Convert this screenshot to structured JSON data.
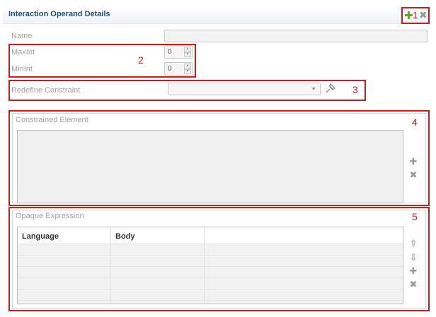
{
  "header": {
    "title": "Interaction Operand Details",
    "callout": "1",
    "add_icon": "add-icon",
    "remove_icon": "remove-icon"
  },
  "fields": {
    "name_label": "Name",
    "name_value": "",
    "maxint_label": "MaxInt",
    "maxint_value": "0",
    "minint_label": "MinInt",
    "minint_value": "0",
    "spinner_callout": "2",
    "redefine_label": "Redefine Constraint",
    "redefine_value": "",
    "redefine_callout": "3"
  },
  "constrained_element": {
    "title": "Constrained Element",
    "callout": "4",
    "items": []
  },
  "opaque_expression": {
    "title": "Opaque Expression",
    "callout": "5",
    "columns": [
      "Language",
      "Body",
      ""
    ],
    "rows": [
      [
        "",
        "",
        ""
      ],
      [
        "",
        "",
        ""
      ],
      [
        "",
        "",
        ""
      ],
      [
        "",
        "",
        ""
      ],
      [
        "",
        "",
        ""
      ],
      [
        "",
        "",
        ""
      ]
    ]
  },
  "colors": {
    "title": "#1f4f86",
    "callout_red": "#cf1b1b",
    "add_green": "#5aa61f"
  }
}
